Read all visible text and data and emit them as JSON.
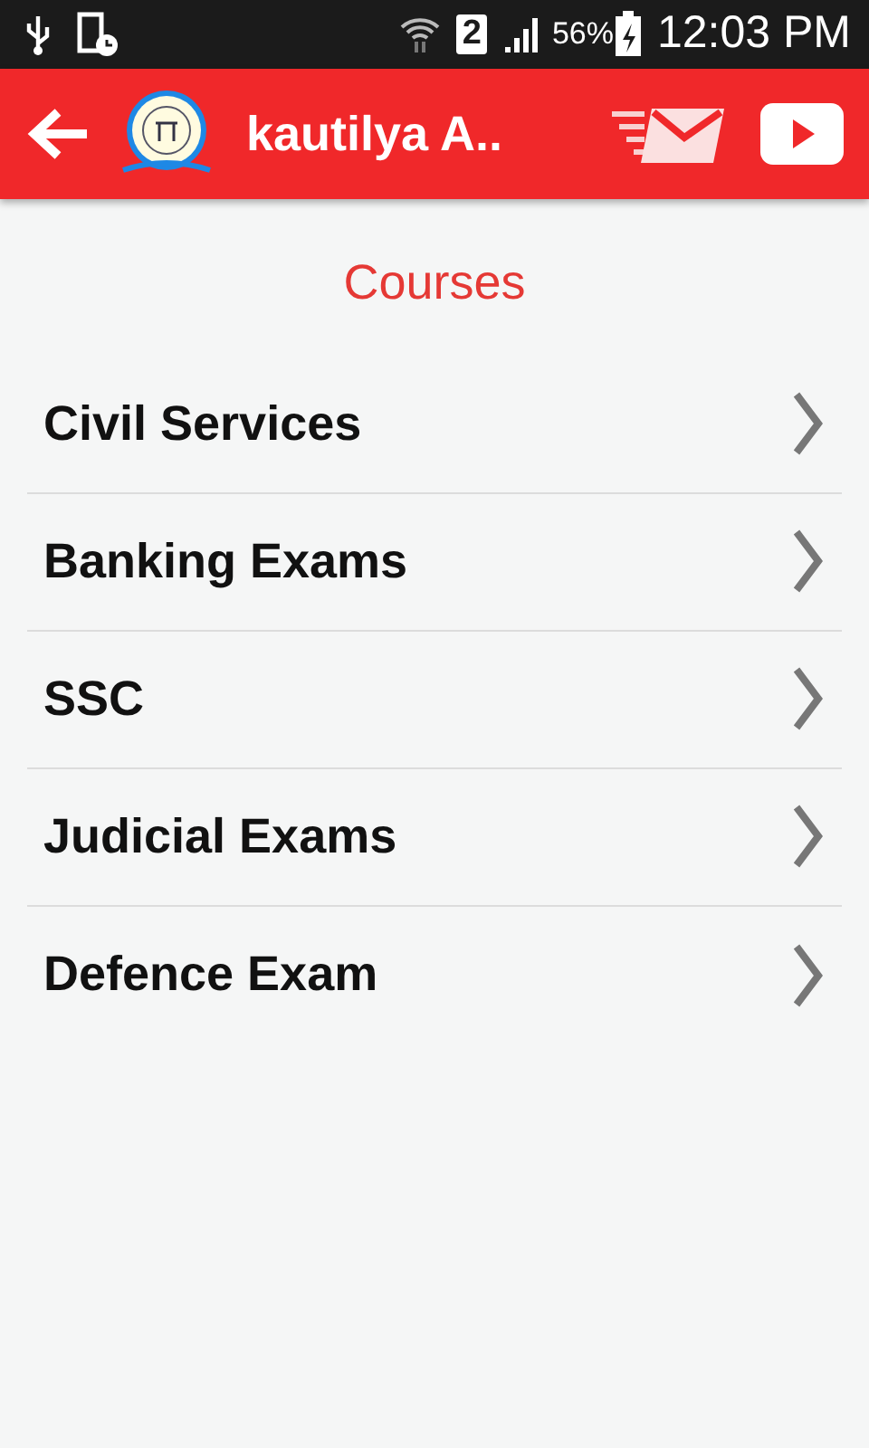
{
  "status_bar": {
    "sim": "2",
    "battery": "56%",
    "time": "12:03 PM"
  },
  "app_bar": {
    "title": "kautilya A.."
  },
  "heading": "Courses",
  "courses": [
    {
      "label": "Civil Services"
    },
    {
      "label": "Banking Exams"
    },
    {
      "label": "SSC"
    },
    {
      "label": "Judicial Exams"
    },
    {
      "label": "Defence Exam"
    }
  ]
}
